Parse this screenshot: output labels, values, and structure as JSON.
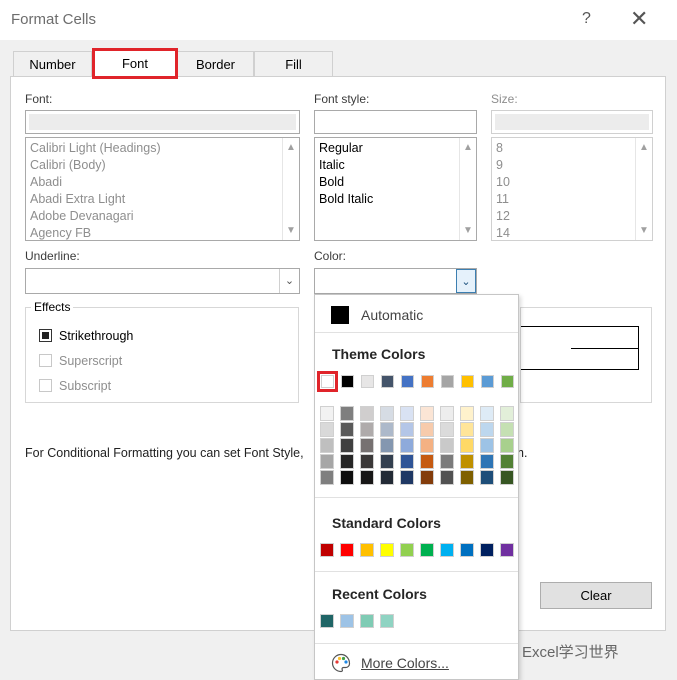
{
  "window": {
    "title": "Format Cells",
    "help": "?",
    "close": "✕"
  },
  "tabs": [
    "Number",
    "Font",
    "Border",
    "Fill"
  ],
  "font": {
    "label": "Font:",
    "items": [
      "Calibri Light (Headings)",
      "Calibri (Body)",
      "Abadi",
      "Abadi Extra Light",
      "Adobe Devanagari",
      "Agency FB"
    ]
  },
  "style": {
    "label": "Font style:",
    "items": [
      "Regular",
      "Italic",
      "Bold",
      "Bold Italic"
    ]
  },
  "size": {
    "label": "Size:",
    "items": [
      "8",
      "9",
      "10",
      "11",
      "12",
      "14"
    ]
  },
  "underline": {
    "label": "Underline:"
  },
  "color": {
    "label": "Color:"
  },
  "effects": {
    "title": "Effects",
    "strikethrough": "Strikethrough",
    "superscript": "Superscript",
    "subscript": "Subscript"
  },
  "note": "For Conditional Formatting you can set Font Style,",
  "note_tail": "h.",
  "clear_label": "Clear",
  "popup": {
    "automatic": "Automatic",
    "theme_title": "Theme Colors",
    "standard_title": "Standard Colors",
    "recent_title": "Recent Colors",
    "more": "More Colors...",
    "theme_top": [
      "#ffffff",
      "#000000",
      "#e7e6e6",
      "#44546a",
      "#4472c4",
      "#ed7d31",
      "#a5a5a5",
      "#ffc000",
      "#5b9bd5",
      "#70ad47"
    ],
    "theme_shades": [
      [
        "#f2f2f2",
        "#d9d9d9",
        "#bfbfbf",
        "#a6a6a6",
        "#7f7f7f"
      ],
      [
        "#7f7f7f",
        "#595959",
        "#404040",
        "#262626",
        "#0d0d0d"
      ],
      [
        "#d0cece",
        "#afabab",
        "#767171",
        "#3a3838",
        "#171616"
      ],
      [
        "#d6dce4",
        "#adb9ca",
        "#8497b0",
        "#333f4f",
        "#222a35"
      ],
      [
        "#d9e2f3",
        "#b4c6e7",
        "#8eaadb",
        "#2f5496",
        "#1f3864"
      ],
      [
        "#fbe5d5",
        "#f7cbac",
        "#f4b183",
        "#c55a11",
        "#833c0b"
      ],
      [
        "#ededed",
        "#dbdbdb",
        "#c9c9c9",
        "#7b7b7b",
        "#525252"
      ],
      [
        "#fff2cc",
        "#ffe599",
        "#ffd966",
        "#bf9000",
        "#7f6000"
      ],
      [
        "#deebf6",
        "#bdd7ee",
        "#9dc3e6",
        "#2e75b5",
        "#1e4e79"
      ],
      [
        "#e2efd9",
        "#c5e0b3",
        "#a8d08d",
        "#538135",
        "#375623"
      ]
    ],
    "standard": [
      "#c00000",
      "#ff0000",
      "#ffc000",
      "#ffff00",
      "#92d050",
      "#00b050",
      "#00b0f0",
      "#0070c0",
      "#002060",
      "#7030a0"
    ],
    "recent": [
      "#1f6566",
      "#9dc3e6",
      "#7fcbb4",
      "#8fd3c2"
    ]
  },
  "watermark": "Excel学习世界"
}
